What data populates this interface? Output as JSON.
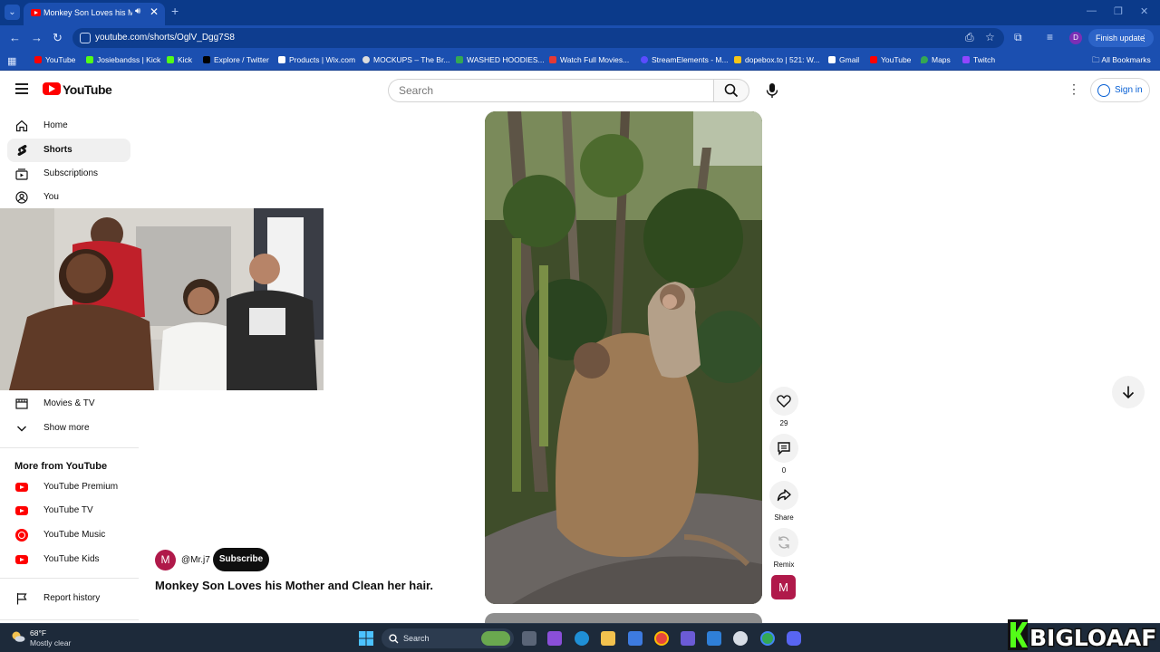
{
  "browser": {
    "tab_title": "Monkey Son Loves his Moth",
    "url": "youtube.com/shorts/OglV_Dgg7S8",
    "finish_update": "Finish update",
    "profile_initial": "D",
    "all_bookmarks": "All Bookmarks",
    "bookmarks": [
      {
        "label": "YouTube",
        "color": "#ff0000"
      },
      {
        "label": "Josiebandss | Kick",
        "color": "#53fc18"
      },
      {
        "label": "Kick",
        "color": "#53fc18"
      },
      {
        "label": "Explore / Twitter",
        "color": "#000000"
      },
      {
        "label": "Products | Wix.com",
        "color": "#ffffff"
      },
      {
        "label": "MOCKUPS – The Br...",
        "color": "#dddddd"
      },
      {
        "label": "WASHED HOODIES...",
        "color": "#34a853"
      },
      {
        "label": "Watch Full Movies...",
        "color": "#e53935"
      },
      {
        "label": "StreamElements - M...",
        "color": "#5b4cff"
      },
      {
        "label": "dopebox.to | 521: W...",
        "color": "#f5c518"
      },
      {
        "label": "Gmail",
        "color": "#ffffff"
      },
      {
        "label": "YouTube",
        "color": "#ff0000"
      },
      {
        "label": "Maps",
        "color": "#34a853"
      },
      {
        "label": "Twitch",
        "color": "#9146ff"
      }
    ]
  },
  "youtube": {
    "logo_text": "YouTube",
    "search_placeholder": "Search",
    "sign_in": "Sign in",
    "sidebar": {
      "items": [
        {
          "label": "Home",
          "icon": "home-icon",
          "active": false
        },
        {
          "label": "Shorts",
          "icon": "shorts-icon",
          "active": true
        },
        {
          "label": "Subscriptions",
          "icon": "subscriptions-icon",
          "active": false
        },
        {
          "label": "You",
          "icon": "you-icon",
          "active": false
        },
        {
          "label": "Movies & TV",
          "icon": "movies-icon",
          "active": false
        },
        {
          "label": "Show more",
          "icon": "chevron-down-icon",
          "active": false
        }
      ],
      "more_from_heading": "More from YouTube",
      "more_from": [
        {
          "label": "YouTube Premium",
          "icon": "youtube-premium-icon"
        },
        {
          "label": "YouTube TV",
          "icon": "youtube-tv-icon"
        },
        {
          "label": "YouTube Music",
          "icon": "youtube-music-icon"
        },
        {
          "label": "YouTube Kids",
          "icon": "youtube-kids-icon"
        }
      ],
      "report_history": "Report history"
    },
    "short": {
      "channel_initial": "M",
      "channel_name": "@Mr.j7",
      "subscribe_label": "Subscribe",
      "title": "Monkey Son Loves his Mother and Clean her hair.",
      "likes": "29",
      "comments": "0",
      "share_label": "Share",
      "remix_label": "Remix",
      "remix_initial": "M"
    }
  },
  "taskbar": {
    "temperature": "68°F",
    "weather": "Mostly clear",
    "search_label": "Search",
    "overlay_text": "BIGLOAAF"
  },
  "colors": {
    "chrome_frame": "#1b4fb0",
    "youtube_red": "#ff0000",
    "link_blue": "#065fd4"
  }
}
